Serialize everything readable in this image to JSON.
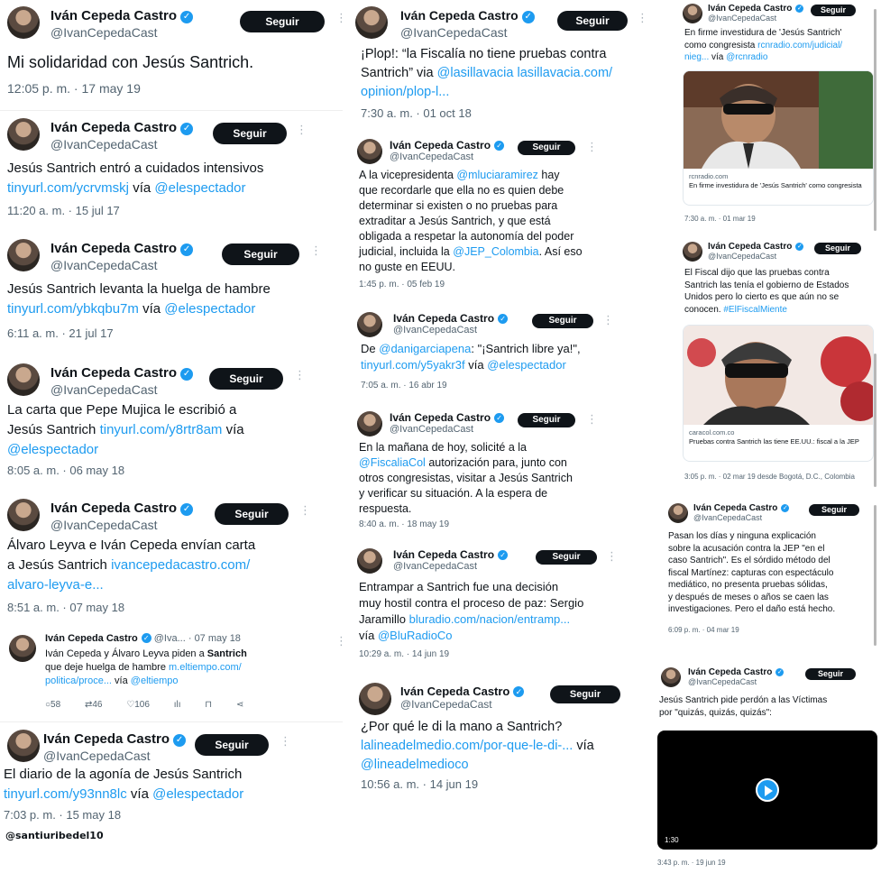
{
  "author": {
    "name": "Iván Cepeda Castro",
    "handle": "@IvanCepedaCast",
    "handle_short": "@Iva...",
    "follow_label": "Seguir"
  },
  "col_a": [
    {
      "text": "Mi solidaridad con Jesús Santrich.",
      "meta": "12:05 p. m. · 17 may 19"
    },
    {
      "line1": "Jesús Santrich entró a cuidados intensivos",
      "link": "tinyurl.com/ycrvmskj",
      "via": "vía",
      "mention": "@elespectador",
      "meta": "11:20 a. m. · 15 jul 17"
    },
    {
      "line1": "Jesús Santrich levanta la huelga de hambre",
      "link": "tinyurl.com/ybkqbu7m",
      "via": "vía",
      "mention": "@elespectador",
      "meta": "6:11 a. m. · 21 jul 17"
    },
    {
      "line1": "La carta que Pepe Mujica le escribió a",
      "line2a": "Jesús Santrich",
      "link": "tinyurl.com/y8rtr8am",
      "via": "vía",
      "mention": "@elespectador",
      "meta": "8:05 a. m. · 06 may 18"
    },
    {
      "line1": "Álvaro Leyva e Iván Cepeda envían carta",
      "line2a": "a Jesús Santrich",
      "link1": "ivancepedacastro.com/",
      "link2": "alvaro-leyva-e...",
      "meta": "8:51 a. m. · 07 may 18"
    },
    {
      "date": "· 07 may 18",
      "line1a": "Iván Cepeda y Álvaro Leyva piden a",
      "line1b": "Santrich",
      "line2a": "que deje huelga de hambre",
      "link1": "m.eltiempo.com/",
      "link2": "politica/proce...",
      "via": "vía",
      "mention": "@eltiempo",
      "replies": "58",
      "retweets": "46",
      "likes": "106"
    },
    {
      "line1": "El diario de la agonía de Jesús Santrich",
      "link": "tinyurl.com/y93nn8lc",
      "via": "vía",
      "mention": "@elespectador",
      "meta": "7:03 p. m. · 15 may 18"
    }
  ],
  "watermark": "@santiuribedel10",
  "col_b": [
    {
      "line1": "¡Plop!: “la Fiscalía no tiene pruebas contra",
      "line2a": "Santrich” via",
      "mention": "@lasillavacia",
      "link1": "lasillavacia.com/",
      "link2": "opinion/plop-l...",
      "meta": "7:30 a. m. · 01 oct 18"
    },
    {
      "line1a": "A la vicepresidenta",
      "mention1": "@mluciaramirez",
      "line1b": "hay",
      "line2": "que recordarle que ella no es quien debe",
      "line3": "determinar si existen o no pruebas para",
      "line4": "extraditar a Jesús Santrich, y que está",
      "line5": "obligada a respetar la autonomía del poder",
      "line6a": "judicial, incluida la",
      "mention2": "@JEP_Colombia",
      "line6b": ". Así eso",
      "line7": "no guste en EEUU.",
      "meta": "1:45 p. m. · 05 feb 19"
    },
    {
      "line1a": "De",
      "mention1": "@danigarciapena",
      "line1b": ": \"¡Santrich libre ya!\",",
      "link": "tinyurl.com/y5yakr3f",
      "via": "vía",
      "mention2": "@elespectador",
      "meta": "7:05 a. m. · 16 abr 19"
    },
    {
      "line1": "En la mañana de hoy, solicité a la",
      "mention": "@FiscaliaCol",
      "line2b": "autorización para, junto con",
      "line3": "otros congresistas, visitar a Jesús Santrich",
      "line4": "y verificar su situación. A la espera de",
      "line5": "respuesta.",
      "meta": "8:40 a. m. · 18 may 19"
    },
    {
      "line1": "Entrampar a Santrich fue una decisión",
      "line2": "muy hostil contra el proceso de paz: Sergio",
      "line3a": "Jaramillo",
      "link": "bluradio.com/nacion/entramp...",
      "line4a": "vía",
      "mention": "@BluRadioCo",
      "meta": "10:29 a. m. · 14 jun 19"
    },
    {
      "line1": "¿Por qué le di la mano a Santrich?",
      "link": "lalineadelmedio.com/por-que-le-di-...",
      "via": "vía",
      "mention": "@lineadelmedioco",
      "meta": "10:56 a. m. · 14 jun 19"
    }
  ],
  "col_c": [
    {
      "line1": "En firme investidura de 'Jesús Santrich'",
      "line2a": "como congresista",
      "link1": "rcnradio.com/judicial/",
      "link2": "nieg...",
      "via": "vía",
      "mention": "@rcnradio",
      "card_domain": "rcnradio.com",
      "card_title": "En firme investidura de 'Jesús Santrich' como congresista",
      "meta": "7:30 a. m. · 01 mar 19"
    },
    {
      "line1": "El Fiscal dijo que las pruebas contra",
      "line2": "Santrich las tenía el gobierno de Estados",
      "line3": "Unidos pero lo cierto es que aún no se",
      "line4a": "conocen.",
      "hashtag": "#ElFiscalMiente",
      "card_domain": "caracol.com.co",
      "card_title": "Pruebas contra Santrich las tiene EE.UU.: fiscal a la JEP",
      "meta": "3:05 p. m. · 02 mar 19 desde Bogotá, D.C., Colombia"
    },
    {
      "lines": [
        "Pasan los días y ninguna explicación",
        "sobre la acusación contra la JEP \"en el",
        "caso Santrich\". Es el sórdido método del",
        "fiscal Martínez: capturas con espectáculo",
        "mediático, no presenta pruebas sólidas,",
        "y después de meses o años se caen las",
        "investigaciones. Pero el daño está hecho."
      ],
      "meta": "6:09 p. m. · 04 mar 19"
    },
    {
      "line1": "Jesús Santrich pide perdón a las Víctimas",
      "line2": "por \"quizás, quizás, quizás\":",
      "video_time": "1:30",
      "meta": "3:43 p. m. · 19 jun 19"
    }
  ]
}
